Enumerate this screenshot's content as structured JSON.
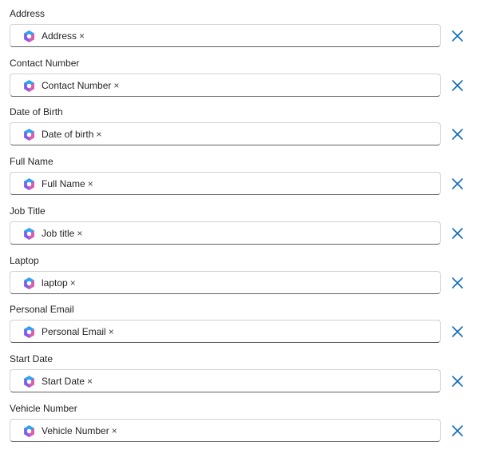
{
  "accent_color": "#0f6cbd",
  "token_icon": "copilot-icon",
  "remove_icon": "close-icon",
  "fields": [
    {
      "label": "Address",
      "token": "Address",
      "token_remove": "×"
    },
    {
      "label": "Contact Number",
      "token": "Contact Number",
      "token_remove": "×"
    },
    {
      "label": "Date of Birth",
      "token": "Date of birth",
      "token_remove": "×"
    },
    {
      "label": "Full Name",
      "token": "Full Name",
      "token_remove": "×"
    },
    {
      "label": "Job Title",
      "token": "Job title",
      "token_remove": "×"
    },
    {
      "label": "Laptop",
      "token": "laptop",
      "token_remove": "×"
    },
    {
      "label": "Personal Email",
      "token": "Personal Email",
      "token_remove": "×"
    },
    {
      "label": "Start Date",
      "token": "Start Date",
      "token_remove": "×"
    },
    {
      "label": "Vehicle Number",
      "token": "Vehicle Number",
      "token_remove": "×"
    }
  ]
}
